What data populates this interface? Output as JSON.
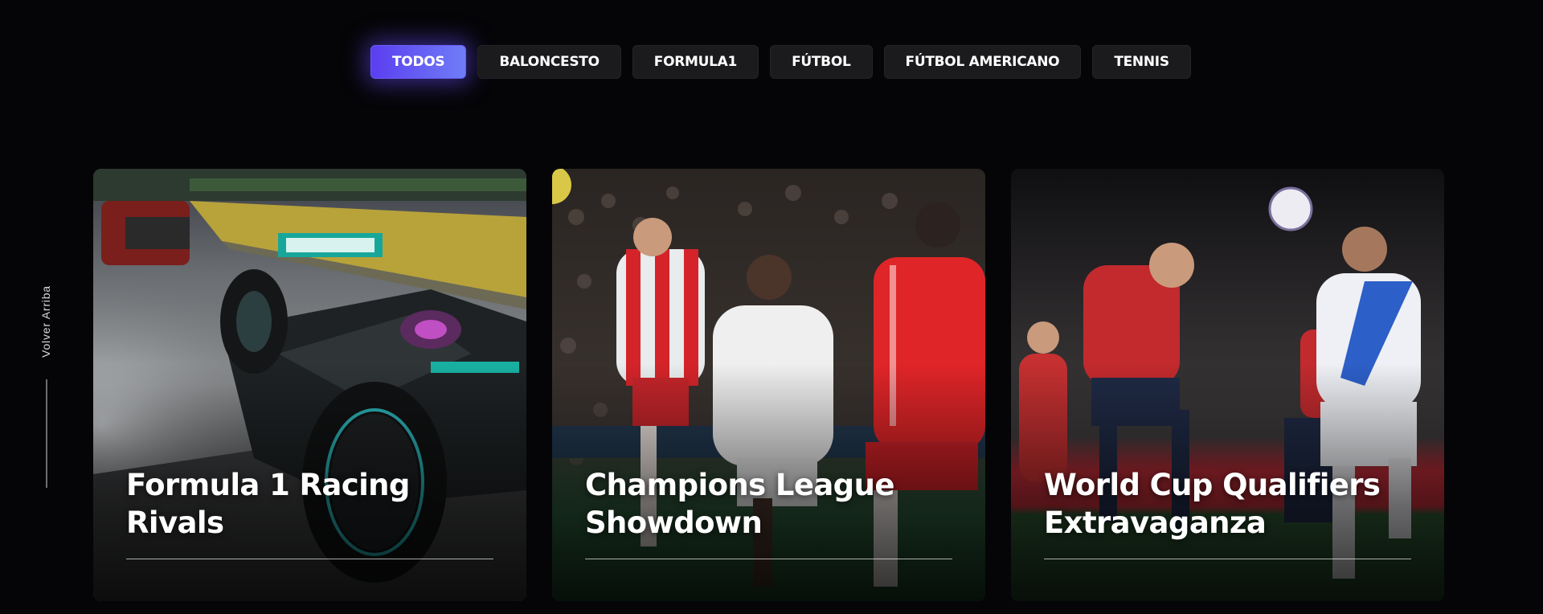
{
  "filters": [
    {
      "label": "TODOS",
      "active": true
    },
    {
      "label": "BALONCESTO",
      "active": false
    },
    {
      "label": "FORMULA1",
      "active": false
    },
    {
      "label": "FÚTBOL",
      "active": false
    },
    {
      "label": "FÚTBOL AMERICANO",
      "active": false
    },
    {
      "label": "TENNIS",
      "active": false
    }
  ],
  "back_to_top": {
    "label": "Volver Arriba"
  },
  "cards": [
    {
      "title": "Formula 1 Racing Rivals",
      "image": "formula-1-car-wet-track-photo"
    },
    {
      "title": "Champions League Showdown",
      "image": "football-players-challenge-photo"
    },
    {
      "title": "World Cup Qualifiers Extravaganza",
      "image": "football-header-duel-photo"
    }
  ],
  "colors": {
    "background": "#050507",
    "active_gradient_start": "#5b3ef0",
    "active_gradient_end": "#6f7df7",
    "button_bg": "#1b1b1e"
  }
}
